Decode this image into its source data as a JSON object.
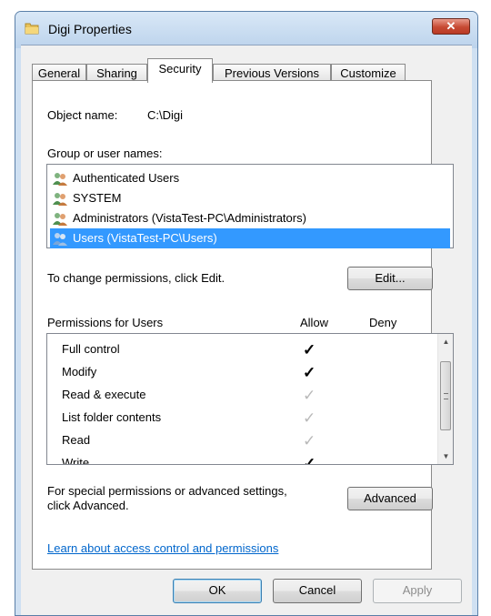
{
  "window": {
    "title": "Digi Properties",
    "close_label": "✕"
  },
  "tabs": [
    {
      "label": "General",
      "active": false
    },
    {
      "label": "Sharing",
      "active": false
    },
    {
      "label": "Security",
      "active": true
    },
    {
      "label": "Previous Versions",
      "active": false
    },
    {
      "label": "Customize",
      "active": false
    }
  ],
  "object": {
    "label": "Object name:",
    "value": "C:\\Digi"
  },
  "groups": {
    "heading": "Group or user names:",
    "items": [
      {
        "label": "Authenticated Users",
        "selected": false
      },
      {
        "label": "SYSTEM",
        "selected": false
      },
      {
        "label": "Administrators (VistaTest-PC\\Administrators)",
        "selected": false
      },
      {
        "label": "Users (VistaTest-PC\\Users)",
        "selected": true
      }
    ]
  },
  "change": {
    "text": "To change permissions, click Edit.",
    "edit_label": "Edit..."
  },
  "permissions": {
    "heading": "Permissions for Users",
    "allow_label": "Allow",
    "deny_label": "Deny",
    "rows": [
      {
        "label": "Full control",
        "allow": "explicit"
      },
      {
        "label": "Modify",
        "allow": "explicit"
      },
      {
        "label": "Read & execute",
        "allow": "inherited"
      },
      {
        "label": "List folder contents",
        "allow": "inherited"
      },
      {
        "label": "Read",
        "allow": "inherited"
      },
      {
        "label": "Write",
        "allow": "explicit"
      }
    ]
  },
  "special": {
    "line1": "For special permissions or advanced settings,",
    "line2": "click Advanced.",
    "advanced_label": "Advanced"
  },
  "learn_link": "Learn about access control and permissions",
  "footer": {
    "ok": "OK",
    "cancel": "Cancel",
    "apply": "Apply"
  },
  "colors": {
    "selection": "#3399ff",
    "link": "#0066cc",
    "close_button": "#c74a33"
  },
  "icons": {
    "folder": "folder-icon",
    "users": "users-icon",
    "check": "✓"
  }
}
